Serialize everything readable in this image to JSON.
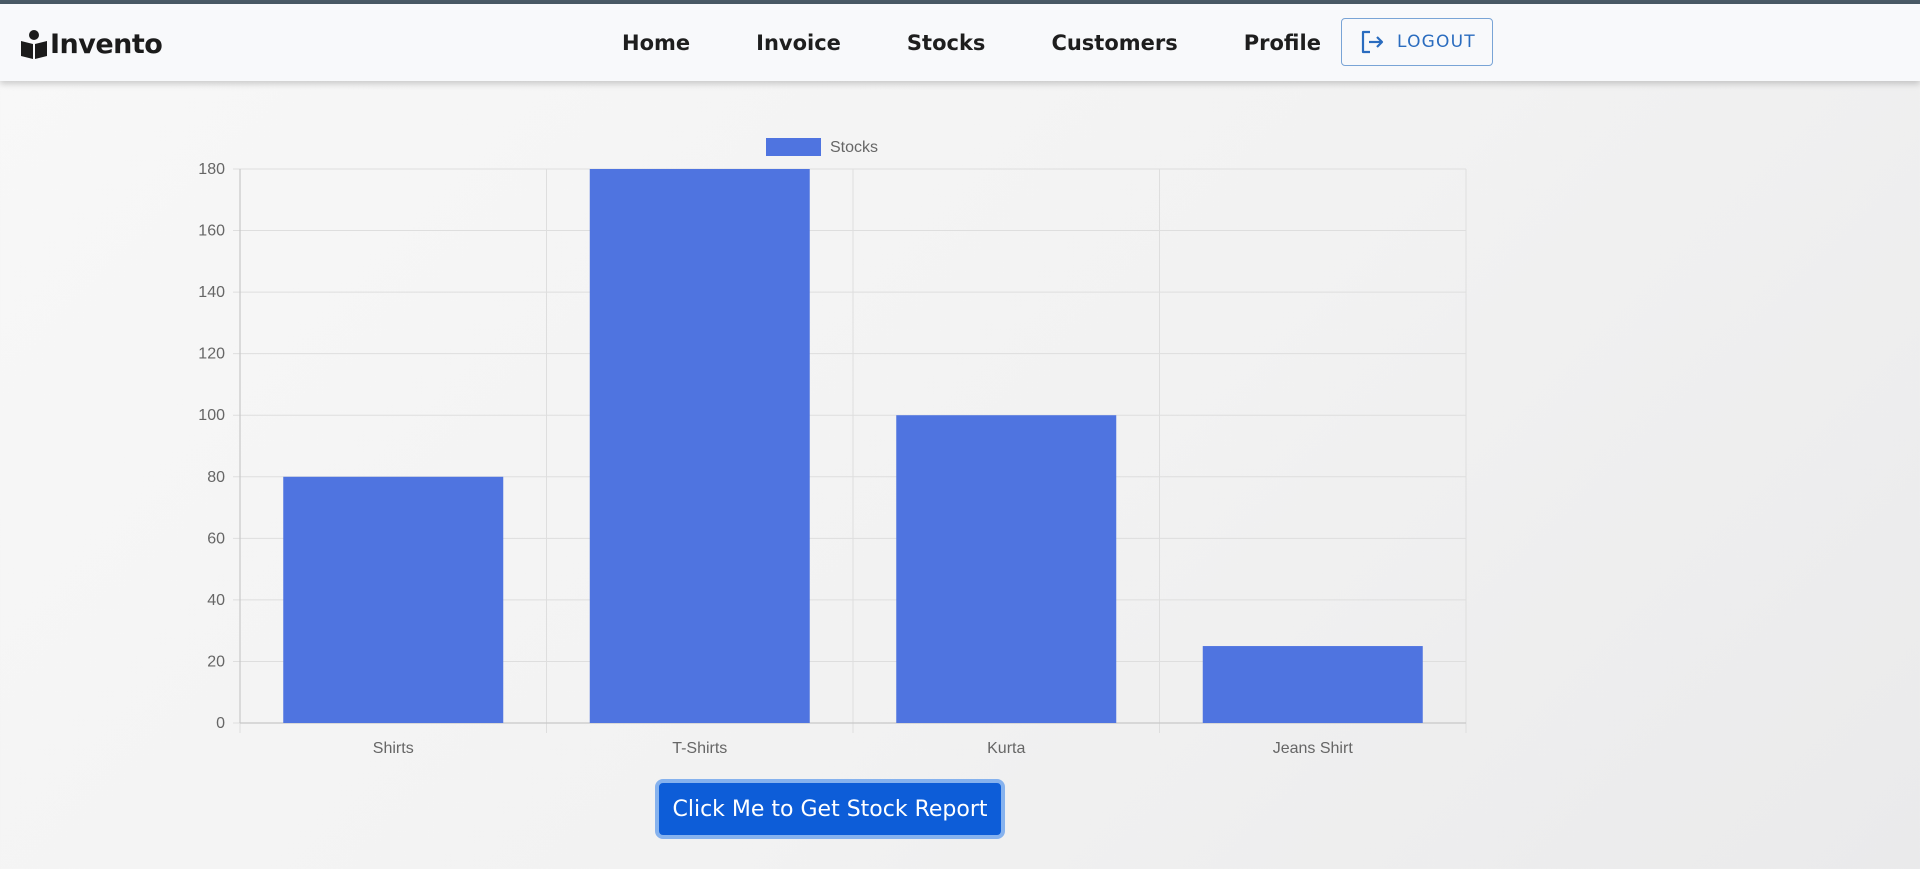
{
  "app": {
    "brand_name": "Invento",
    "brand_icon": "book-reader-icon"
  },
  "nav": {
    "items": [
      {
        "label": "Home"
      },
      {
        "label": "Invoice"
      },
      {
        "label": "Stocks"
      },
      {
        "label": "Customers"
      },
      {
        "label": "Profile"
      }
    ],
    "logout_label": "LOGOUT",
    "logout_icon": "sign-out-icon"
  },
  "report_button_label": "Click Me to Get Stock Report",
  "colors": {
    "bar": "#4f74e0",
    "accent": "#0d5dd8",
    "logout": "#2a6cbf"
  },
  "chart_data": {
    "type": "bar",
    "categories": [
      "Shirts",
      "T-Shirts",
      "Kurta",
      "Jeans Shirt"
    ],
    "series": [
      {
        "name": "Stocks",
        "values": [
          80,
          180,
          100,
          25
        ]
      }
    ],
    "ylim": [
      0,
      180
    ],
    "yticks": [
      0,
      20,
      40,
      60,
      80,
      100,
      120,
      140,
      160,
      180
    ],
    "grid": true,
    "legend": "top-center"
  }
}
